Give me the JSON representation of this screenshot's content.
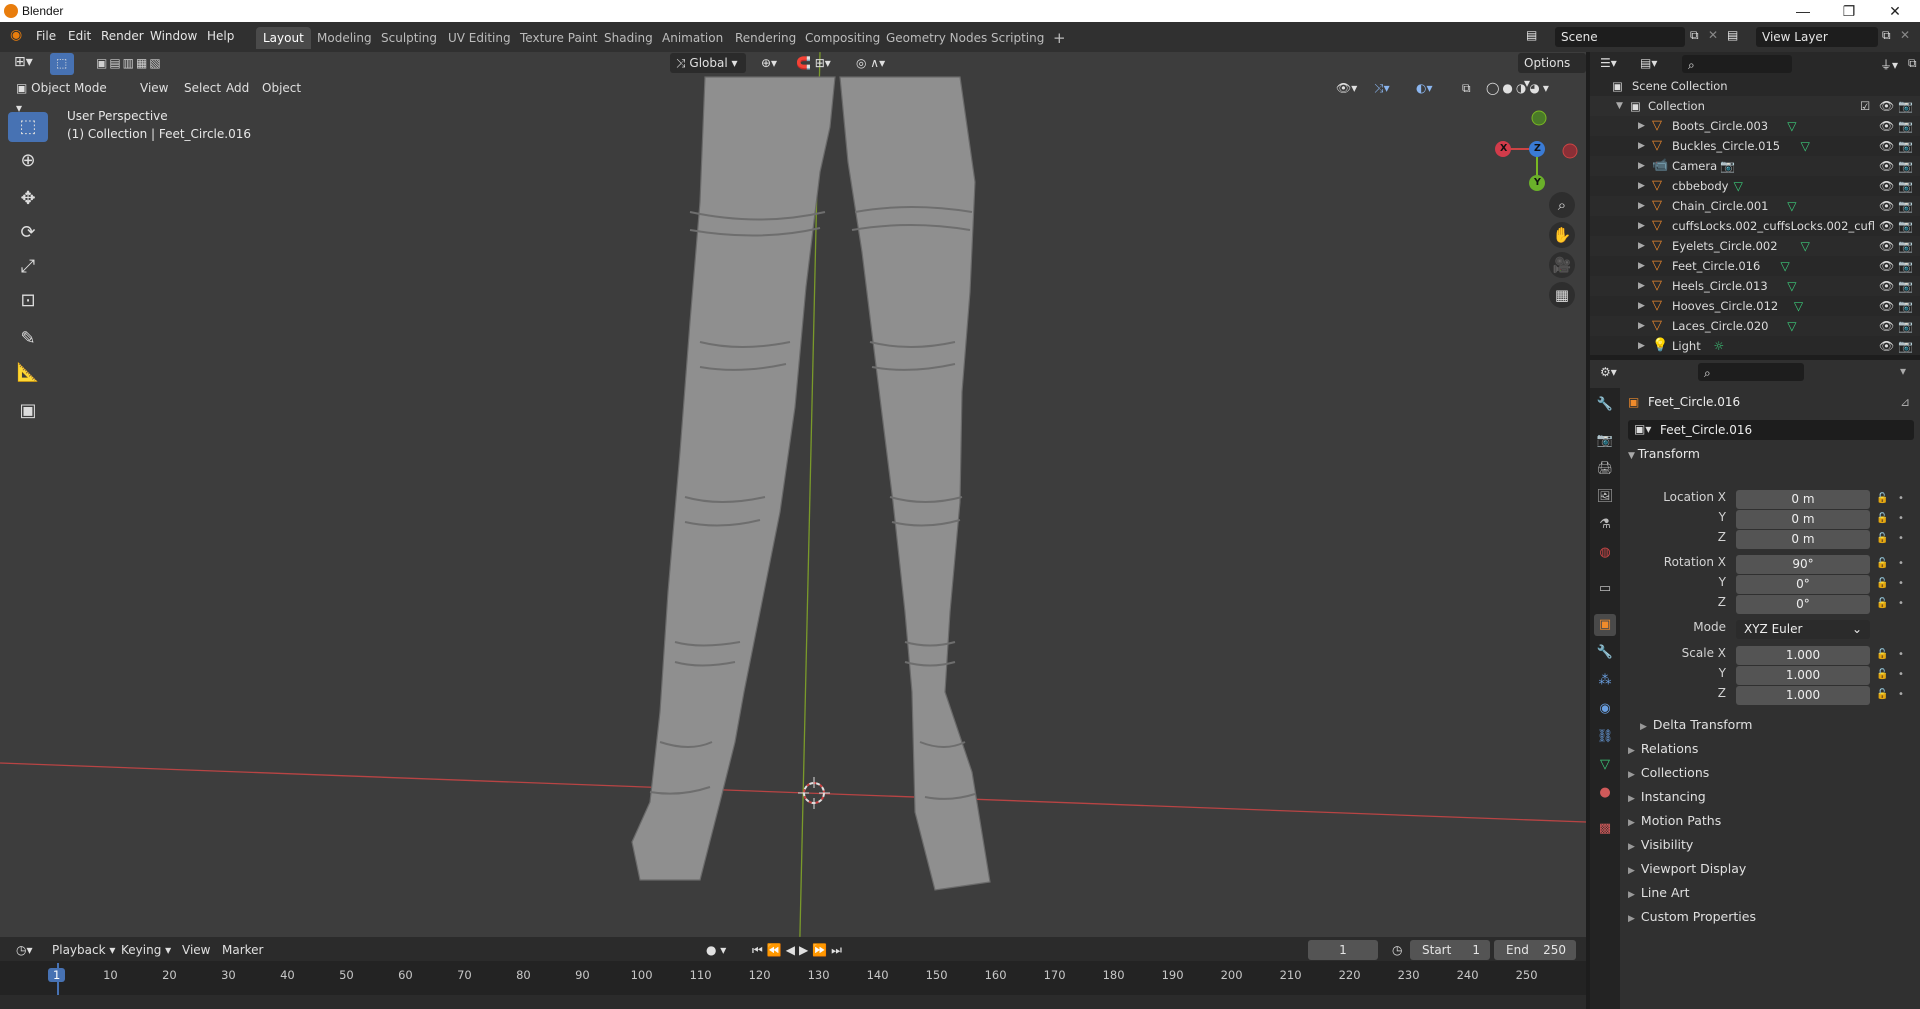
{
  "window": {
    "title": "Blender"
  },
  "menu": [
    "File",
    "Edit",
    "Render",
    "Window",
    "Help"
  ],
  "workspaces": [
    "Layout",
    "Modeling",
    "Sculpting",
    "UV Editing",
    "Texture Paint",
    "Shading",
    "Animation",
    "Rendering",
    "Compositing",
    "Geometry Nodes",
    "Scripting"
  ],
  "active_workspace": "Layout",
  "scene": {
    "name": "Scene",
    "view_layer": "View Layer"
  },
  "viewport": {
    "transform_orientation": "Global",
    "options_label": "Options",
    "mode": "Object Mode",
    "menus": [
      "View",
      "Select",
      "Add",
      "Object"
    ],
    "overlay_text_1": "User Perspective",
    "overlay_text_2": "(1) Collection | Feet_Circle.016",
    "axes": {
      "x": "X",
      "y": "Y",
      "z": "Z"
    }
  },
  "outliner": {
    "root": "Scene Collection",
    "collection": "Collection",
    "items": [
      {
        "name": "Boots_Circle.003",
        "icon": "mesh-object-icon"
      },
      {
        "name": "Buckles_Circle.015",
        "icon": "mesh-object-icon"
      },
      {
        "name": "Camera",
        "icon": "camera-object-icon"
      },
      {
        "name": "cbbebody",
        "icon": "mesh-object-icon"
      },
      {
        "name": "Chain_Circle.001",
        "icon": "mesh-object-icon"
      },
      {
        "name": "cuffsLocks.002_cuffsLocks.002_cufl",
        "icon": "mesh-object-icon"
      },
      {
        "name": "Eyelets_Circle.002",
        "icon": "mesh-object-icon"
      },
      {
        "name": "Feet_Circle.016",
        "icon": "mesh-object-icon"
      },
      {
        "name": "Heels_Circle.013",
        "icon": "mesh-object-icon"
      },
      {
        "name": "Hooves_Circle.012",
        "icon": "mesh-object-icon"
      },
      {
        "name": "Laces_Circle.020",
        "icon": "mesh-object-icon"
      },
      {
        "name": "Light",
        "icon": "light-object-icon"
      }
    ]
  },
  "properties": {
    "object_name": "Feet_Circle.016",
    "datablock_name": "Feet_Circle.016",
    "transform_header": "Transform",
    "location": {
      "label": "Location X",
      "x": "0 m",
      "y": "0 m",
      "z": "0 m"
    },
    "rotation": {
      "label": "Rotation X",
      "x": "90°",
      "y": "0°",
      "z": "0°"
    },
    "mode_label": "Mode",
    "mode_value": "XYZ Euler",
    "scale": {
      "label": "Scale X",
      "x": "1.000",
      "y": "1.000",
      "z": "1.000"
    },
    "axis_y": "Y",
    "axis_z": "Z",
    "subpanels": [
      "Delta Transform"
    ],
    "panels": [
      "Relations",
      "Collections",
      "Instancing",
      "Motion Paths",
      "Visibility",
      "Viewport Display",
      "Line Art",
      "Custom Properties"
    ]
  },
  "timeline": {
    "menus": [
      "Playback",
      "Keying",
      "View",
      "Marker"
    ],
    "current_frame": "1",
    "start_label": "Start",
    "start": "1",
    "end_label": "End",
    "end": "250",
    "ticks": [
      "1",
      "10",
      "20",
      "30",
      "40",
      "50",
      "60",
      "70",
      "80",
      "90",
      "100",
      "110",
      "120",
      "130",
      "140",
      "150",
      "160",
      "170",
      "180",
      "190",
      "200",
      "210",
      "220",
      "230",
      "240",
      "250"
    ]
  }
}
